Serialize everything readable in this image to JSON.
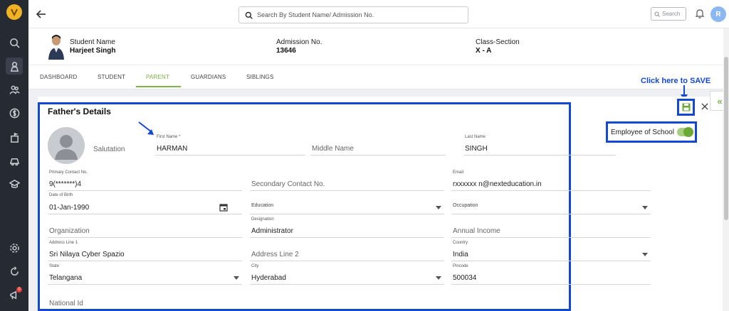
{
  "topbar": {
    "search_placeholder": "Search By Student Name/ Admission No.",
    "small_search_placeholder": "Search",
    "user_initial": "R"
  },
  "student": {
    "name_label": "Student Name",
    "name_value": "Harjeet Singh",
    "admission_label": "Admission No.",
    "admission_value": "13646",
    "class_label": "Class-Section",
    "class_value": "X - A"
  },
  "tabs": [
    "DASHBOARD",
    "STUDENT",
    "PARENT",
    "GUARDIANS",
    "SIBLINGS"
  ],
  "active_tab": "PARENT",
  "section": {
    "title": "Father's Details",
    "save_hint": "Click here to SAVE",
    "employee_label": "Employee of School",
    "employee_toggle_on": true
  },
  "fields": {
    "salutation": {
      "placeholder": "Salutation"
    },
    "first_name": {
      "label": "First Name *",
      "value": "HARMAN"
    },
    "middle_name": {
      "placeholder": "Middle Name"
    },
    "last_name": {
      "label": "Last Name",
      "value": "SINGH"
    },
    "primary_contact": {
      "label": "Primary Contact No.",
      "value": "9(*******)4"
    },
    "secondary_contact": {
      "placeholder": "Secondary Contact No."
    },
    "email": {
      "label": "Email",
      "value": "rxxxxxx n@nexteducation.in"
    },
    "dob": {
      "label": "Date of Birth",
      "value": "01-Jan-1990"
    },
    "education": {
      "label": "Education"
    },
    "occupation": {
      "label": "Occupation"
    },
    "organization": {
      "placeholder": "Organization"
    },
    "designation": {
      "label": "Designation",
      "value": "Administrator"
    },
    "annual_income": {
      "placeholder": "Annual Income"
    },
    "address1": {
      "label": "Address Line 1",
      "value": "Sri Nilaya Cyber Spazio"
    },
    "address2": {
      "placeholder": "Address Line 2"
    },
    "country": {
      "label": "Country",
      "value": "India"
    },
    "state": {
      "label": "State",
      "value": "Telangana"
    },
    "city": {
      "label": "City",
      "value": "Hyderabad"
    },
    "pincode": {
      "label": "Pincode",
      "value": "500034"
    },
    "national_id": {
      "placeholder": "National Id"
    }
  },
  "colors": {
    "accent_green": "#7cb342",
    "annotation_blue": "#1347d6",
    "sidebar_bg": "#262b33"
  },
  "icons": [
    "home-icon",
    "search-icon",
    "student-icon",
    "users-icon",
    "fee-icon",
    "exam-icon",
    "transport-icon",
    "library-icon",
    "settings-icon",
    "refresh-icon",
    "announce-icon",
    "bell-icon",
    "save-icon",
    "close-icon",
    "calendar-icon",
    "back-arrow-icon",
    "collapse-icon"
  ]
}
